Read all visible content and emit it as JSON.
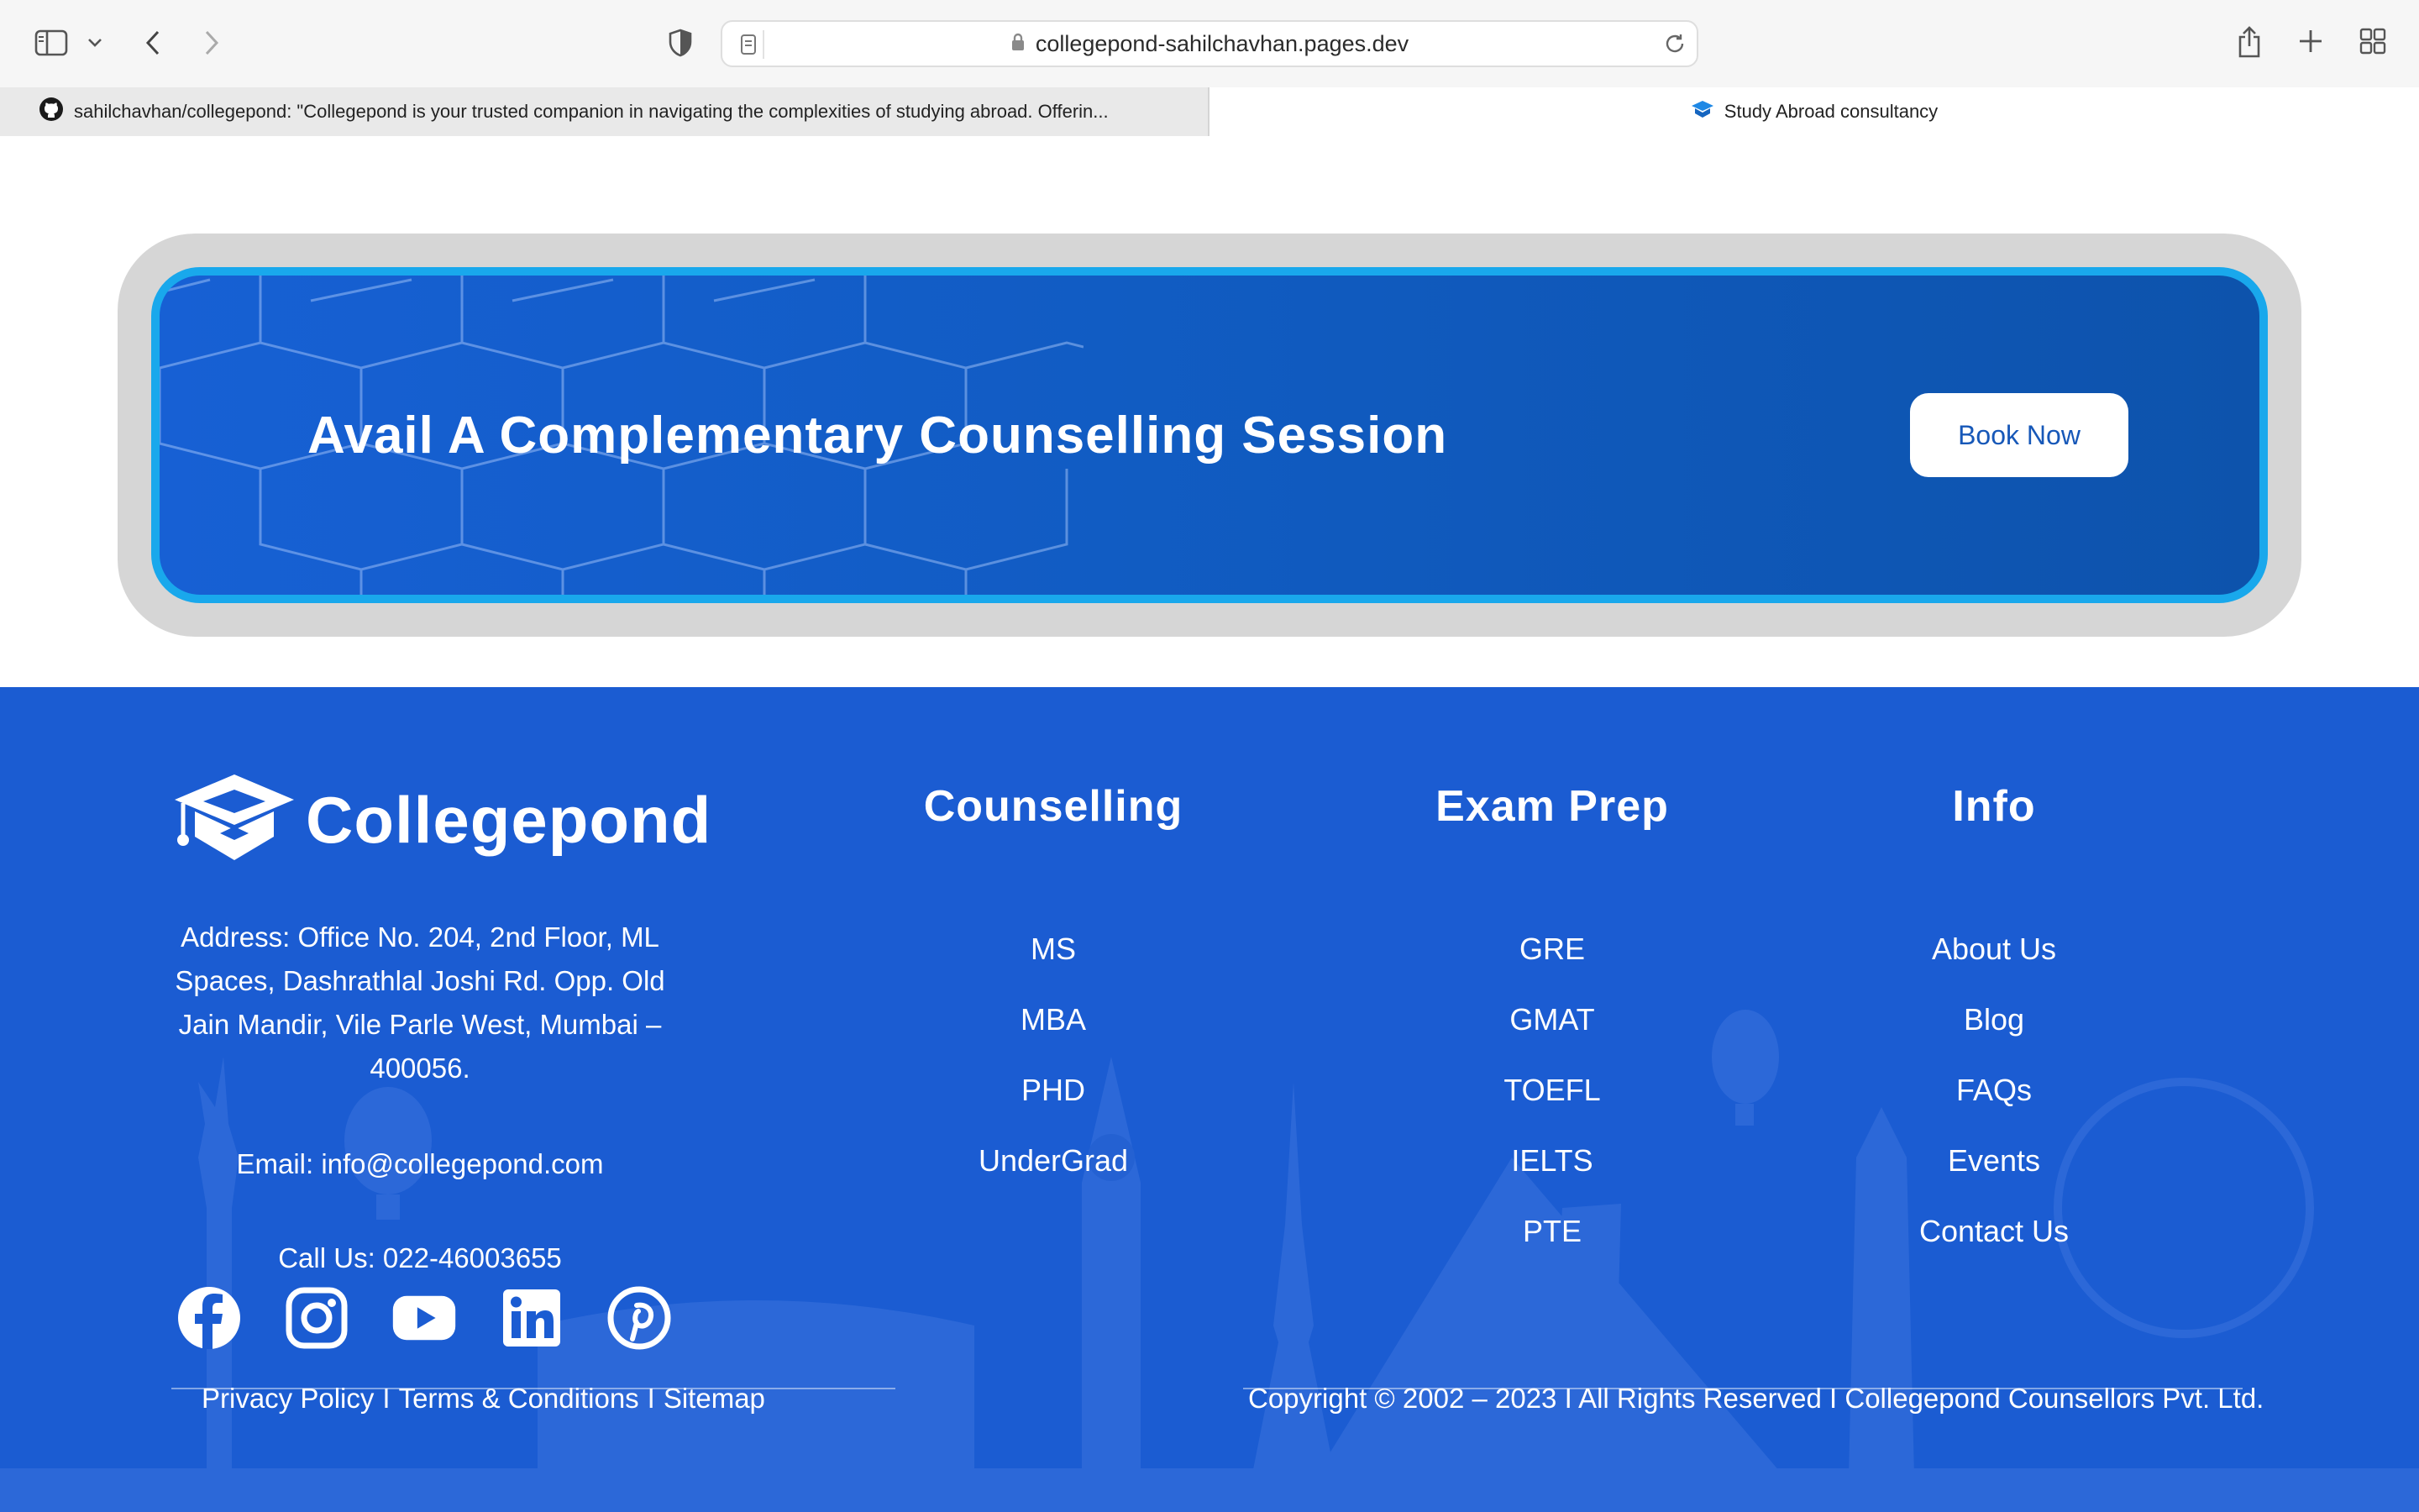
{
  "browser": {
    "url": "collegepond-sahilchavhan.pages.dev",
    "tabs": [
      {
        "label": "sahilchavhan/collegepond: \"Collegepond is your trusted companion in navigating the complexities of studying abroad. Offerin...",
        "icon": "github-icon",
        "active": false
      },
      {
        "label": "Study Abroad consultancy",
        "icon": "collegepond-favicon",
        "active": true
      }
    ]
  },
  "cta": {
    "title": "Avail A Complementary Counselling Session",
    "button_label": "Book Now"
  },
  "footer": {
    "brand": "Collegepond",
    "address": "Address: Office No. 204, 2nd Floor, ML Spaces, Dashrathlal Joshi Rd. Opp. Old Jain Mandir, Vile Parle West, Mumbai – 400056.",
    "email": "Email: info@collegepond.com",
    "phone": "Call Us: 022-46003655",
    "social": [
      "facebook-icon",
      "instagram-icon",
      "youtube-icon",
      "linkedin-icon",
      "pinterest-icon"
    ],
    "columns": [
      {
        "title": "Counselling",
        "items": [
          "MS",
          "MBA",
          "PHD",
          "UnderGrad"
        ]
      },
      {
        "title": "Exam Prep",
        "items": [
          "GRE",
          "GMAT",
          "TOEFL",
          "IELTS",
          "PTE"
        ]
      },
      {
        "title": "Info",
        "items": [
          "About Us",
          "Blog",
          "FAQs",
          "Events",
          "Contact Us"
        ]
      }
    ],
    "legal": {
      "privacy": "Privacy Policy",
      "terms": "Terms & Conditions",
      "sitemap": "Sitemap",
      "separator": "I"
    },
    "copyright": "Copyright © 2002 – 2023 I All Rights Reserved I Collegepond Counsellors Pvt. Ltd."
  },
  "colors": {
    "footer_bg": "#1b5cd2",
    "banner_border": "#19a8ec",
    "banner_frame": "#d6d6d6",
    "button_text": "#1758b8"
  }
}
